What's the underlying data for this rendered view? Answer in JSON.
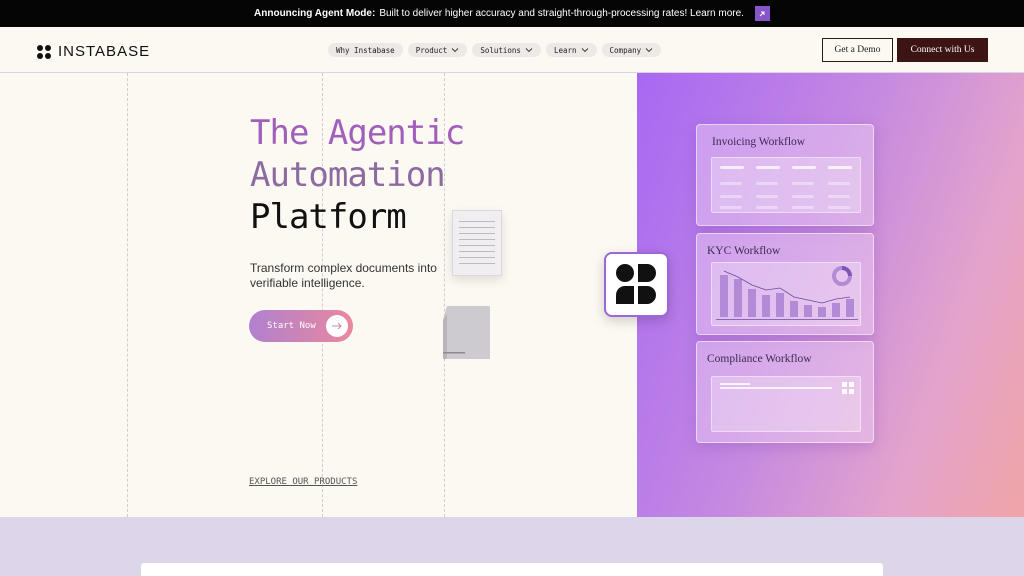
{
  "announcement": {
    "bold": "Announcing Agent Mode:",
    "text": "Built to deliver higher accuracy and straight-through-processing rates! Learn more.",
    "arrow_icon": "arrow-up-right-icon",
    "accent": "#8757c9"
  },
  "nav": {
    "logo_text": "INSTABASE",
    "menu": [
      {
        "label": "Why Instabase"
      },
      {
        "label": "Product"
      },
      {
        "label": "Solutions"
      },
      {
        "label": "Learn"
      },
      {
        "label": "Company"
      }
    ],
    "demo_label": "Get a Demo",
    "connect_label": "Connect with Us"
  },
  "hero": {
    "line1": "The Agentic",
    "line2": "Automation",
    "line3": "Platform",
    "subtitle": "Transform complex documents into verifiable intelligence.",
    "start_label": "Start Now",
    "explore_label": "EXPLORE OUR PRODUCTS"
  },
  "workflows": [
    {
      "title": "Invoicing Workflow"
    },
    {
      "title": "KYC Workflow"
    },
    {
      "title": "Compliance Workflow"
    }
  ],
  "colors": {
    "panel_start": "#a868f3",
    "panel_end": "#efa4a7",
    "connect_bg": "#3b1413",
    "page_bg": "#fcf9f2"
  }
}
